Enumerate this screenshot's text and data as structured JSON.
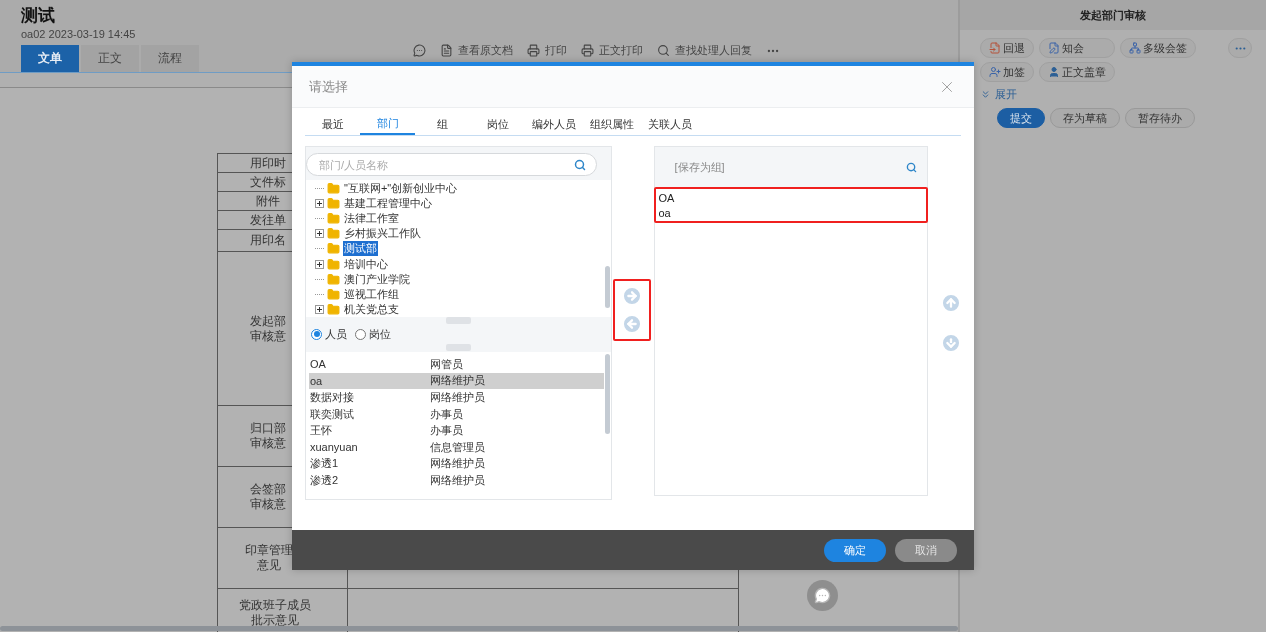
{
  "document": {
    "title": "测试",
    "meta": "oa02 2023-03-19 14:45",
    "tabs": [
      {
        "label": "文单",
        "selected": true
      },
      {
        "label": "正文",
        "selected": false
      },
      {
        "label": "流程",
        "selected": false
      }
    ],
    "toolbar": [
      {
        "kind": "comment"
      },
      {
        "kind": "document",
        "label": "查看原文档"
      },
      {
        "kind": "print",
        "label": "打印"
      },
      {
        "kind": "print",
        "label": "正文打印"
      },
      {
        "kind": "search",
        "label": "查找处理人回复"
      },
      {
        "kind": "more"
      }
    ],
    "form_rows": [
      {
        "lines": [
          "用印时"
        ],
        "kind": "field"
      },
      {
        "lines": [
          "文件标"
        ],
        "kind": "field"
      },
      {
        "lines": [
          "附件"
        ],
        "kind": "field"
      },
      {
        "lines": [
          "发往单"
        ],
        "kind": "field"
      },
      {
        "lines": [
          "用印名"
        ],
        "kind": "name_field"
      },
      {
        "lines": [
          "发起部",
          "审核意"
        ],
        "kind": "main_opinion"
      },
      {
        "lines": [
          "归口部",
          "审核意"
        ],
        "kind": "opinion"
      },
      {
        "lines": [
          "会签部",
          "审核意"
        ],
        "kind": "opinion"
      },
      {
        "lines": [
          "印章管理",
          "意见"
        ],
        "kind": "opinion"
      },
      {
        "lines": [
          "党政班子成员",
          "批示意见"
        ],
        "kind": "last_opinion"
      }
    ]
  },
  "side_panel": {
    "title": "发起部门审核",
    "actions": [
      {
        "kind": "return",
        "label": "回退"
      },
      {
        "kind": "notify",
        "label": "知会"
      },
      {
        "kind": "countersign",
        "label": "多级会签"
      },
      {
        "kind": "addsign",
        "label": "加签"
      },
      {
        "kind": "stamp",
        "label": "正文盖章"
      }
    ],
    "expand": "展开",
    "buttons": [
      {
        "label": "提交",
        "kind": "primary"
      },
      {
        "label": "存为草稿",
        "kind": "default"
      },
      {
        "label": "暂存待办",
        "kind": "default"
      }
    ]
  },
  "dialog": {
    "title": "请选择",
    "tabs": [
      {
        "label": "最近",
        "selected": false
      },
      {
        "label": "部门",
        "selected": true
      },
      {
        "label": "组",
        "selected": false
      },
      {
        "label": "岗位",
        "selected": false
      },
      {
        "label": "编外人员",
        "selected": false
      },
      {
        "label": "组织属性",
        "selected": false
      },
      {
        "label": "关联人员",
        "selected": false
      }
    ],
    "search": {
      "placeholder": "部门/人员名称"
    },
    "tree": [
      {
        "label": "\"互联网+\"创新创业中心",
        "expandable": false,
        "selected": false
      },
      {
        "label": "基建工程管理中心",
        "expandable": true,
        "selected": false
      },
      {
        "label": "法律工作室",
        "expandable": false,
        "selected": false
      },
      {
        "label": "乡村振兴工作队",
        "expandable": true,
        "selected": false
      },
      {
        "label": "测试部",
        "expandable": false,
        "selected": true
      },
      {
        "label": "培训中心",
        "expandable": true,
        "selected": false
      },
      {
        "label": "澳门产业学院",
        "expandable": false,
        "selected": false
      },
      {
        "label": "巡视工作组",
        "expandable": false,
        "selected": false
      },
      {
        "label": "机关党总支",
        "expandable": true,
        "selected": false
      }
    ],
    "radios": [
      {
        "label": "人员",
        "selected": true
      },
      {
        "label": "岗位",
        "selected": false
      }
    ],
    "people": [
      {
        "name": "OA",
        "role": "网管员",
        "selected": false
      },
      {
        "name": "oa",
        "role": "网络维护员",
        "selected": true
      },
      {
        "name": "数据对接",
        "role": "网络维护员",
        "selected": false
      },
      {
        "name": "联奕测试",
        "role": "办事员",
        "selected": false
      },
      {
        "name": "王怀",
        "role": "办事员",
        "selected": false
      },
      {
        "name": "xuanyuan",
        "role": "信息管理员",
        "selected": false
      },
      {
        "name": "渗透1",
        "role": "网络维护员",
        "selected": false
      },
      {
        "name": "渗透2",
        "role": "网络维护员",
        "selected": false
      }
    ],
    "selected_header": "[保存为组]",
    "selected_items": [
      "OA",
      "oa"
    ],
    "buttons": [
      {
        "label": "确定",
        "kind": "primary"
      },
      {
        "label": "取消",
        "kind": "default"
      }
    ]
  }
}
